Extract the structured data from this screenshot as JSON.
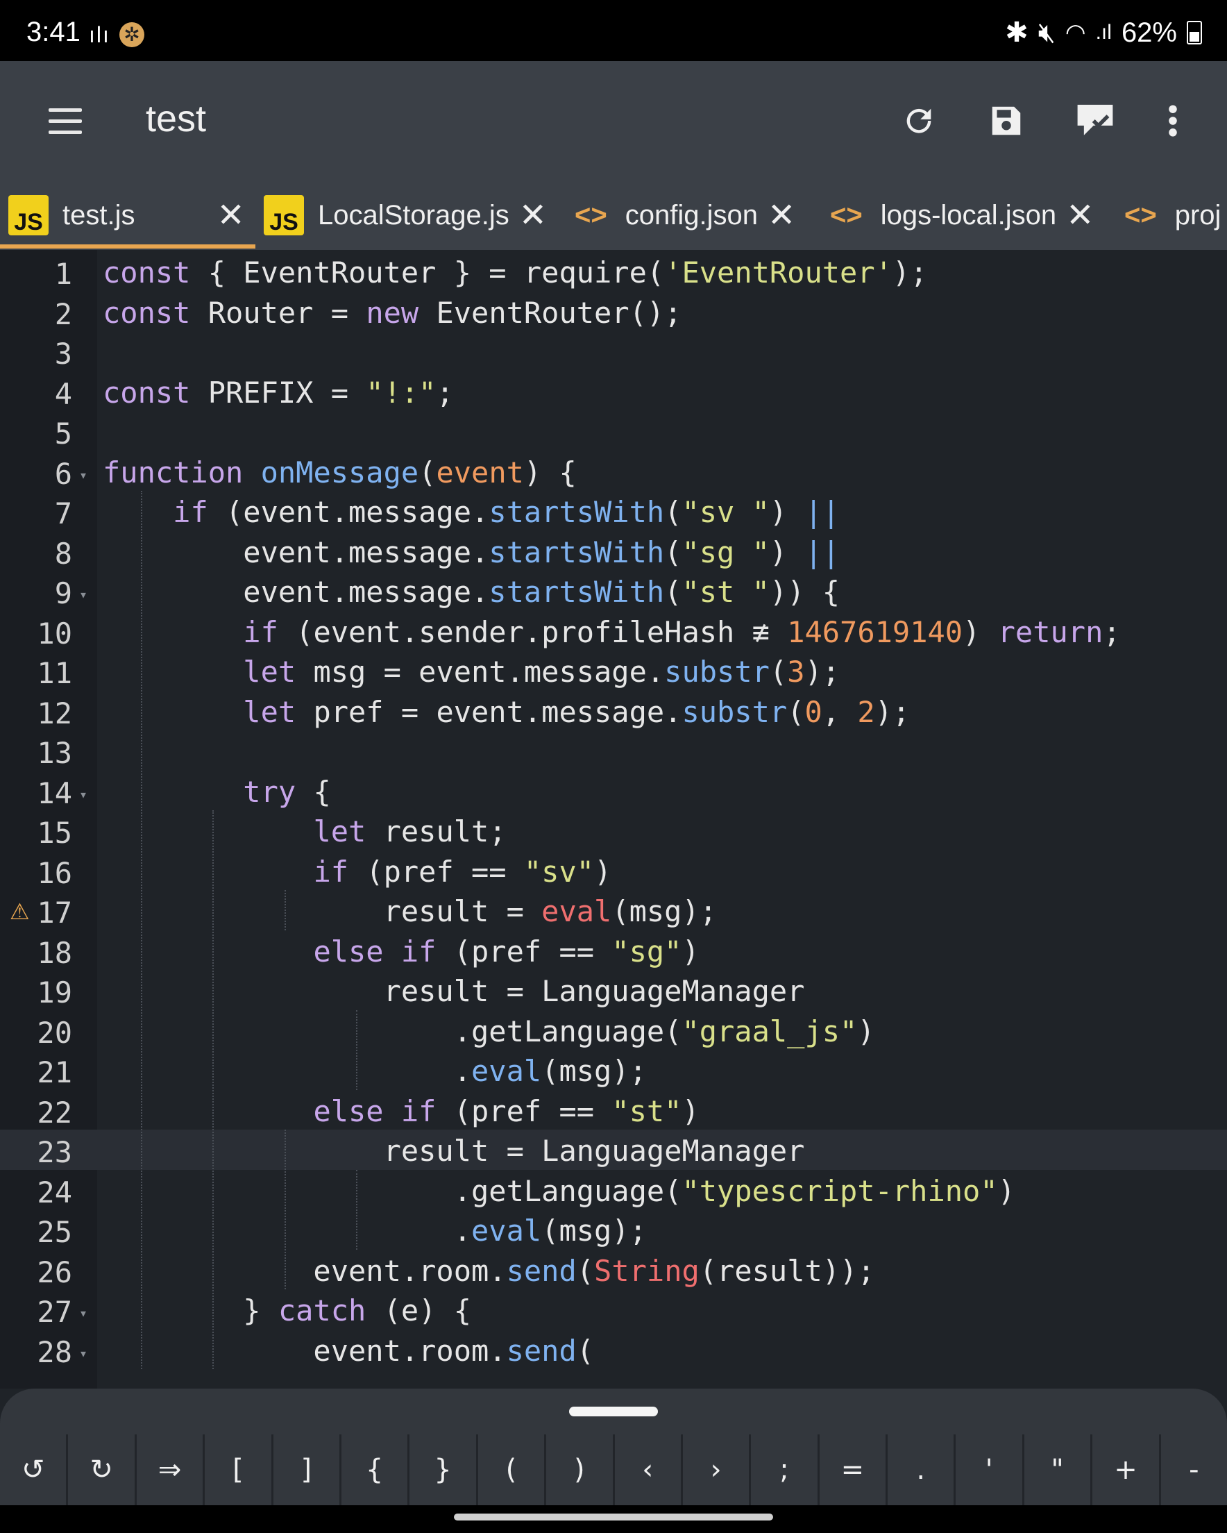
{
  "status_bar": {
    "time": "3:41",
    "battery": "62%"
  },
  "toolbar": {
    "title": "test",
    "icons": [
      "menu-icon",
      "refresh-icon",
      "save-icon",
      "run-icon",
      "more-vert-icon"
    ]
  },
  "tabs": [
    {
      "icon": "JS",
      "label": "test.js",
      "active": true
    },
    {
      "icon": "JS",
      "label": "LocalStorage.js",
      "active": false
    },
    {
      "icon": "<>",
      "label": "config.json",
      "active": false
    },
    {
      "icon": "<>",
      "label": "logs-local.json",
      "active": false
    },
    {
      "icon": "<>",
      "label": "proj",
      "active": false
    }
  ],
  "editor": {
    "active_line": 23,
    "warning_line": 17,
    "lines": [
      {
        "n": "1",
        "tokens": [
          [
            "kw",
            "const"
          ],
          [
            "op",
            " { EventRouter } = require("
          ],
          [
            "str",
            "'EventRouter'"
          ],
          [
            "op",
            ");"
          ]
        ]
      },
      {
        "n": "2",
        "tokens": [
          [
            "kw",
            "const"
          ],
          [
            "op",
            " Router = "
          ],
          [
            "kw",
            "new"
          ],
          [
            "op",
            " EventRouter();"
          ]
        ]
      },
      {
        "n": "3",
        "tokens": []
      },
      {
        "n": "4",
        "tokens": [
          [
            "kw",
            "const"
          ],
          [
            "op",
            " PREFIX = "
          ],
          [
            "str",
            "\"!:\""
          ],
          [
            "op",
            ";"
          ]
        ]
      },
      {
        "n": "5",
        "tokens": []
      },
      {
        "n": "6",
        "fold": true,
        "tokens": [
          [
            "kw",
            "function"
          ],
          [
            "op",
            " "
          ],
          [
            "fn",
            "onMessage"
          ],
          [
            "op",
            "("
          ],
          [
            "param",
            "event"
          ],
          [
            "op",
            ") {"
          ]
        ]
      },
      {
        "n": "7",
        "tokens": [
          [
            "op",
            "    "
          ],
          [
            "kw",
            "if"
          ],
          [
            "op",
            " (event.message."
          ],
          [
            "fn",
            "startsWith"
          ],
          [
            "op",
            "("
          ],
          [
            "str",
            "\"sv \""
          ],
          [
            "op",
            ") "
          ],
          [
            "fn",
            "||"
          ]
        ]
      },
      {
        "n": "8",
        "tokens": [
          [
            "op",
            "        event.message."
          ],
          [
            "fn",
            "startsWith"
          ],
          [
            "op",
            "("
          ],
          [
            "str",
            "\"sg \""
          ],
          [
            "op",
            ") "
          ],
          [
            "fn",
            "||"
          ]
        ]
      },
      {
        "n": "9",
        "fold": true,
        "tokens": [
          [
            "op",
            "        event.message."
          ],
          [
            "fn",
            "startsWith"
          ],
          [
            "op",
            "("
          ],
          [
            "str",
            "\"st \""
          ],
          [
            "op",
            ")) {"
          ]
        ]
      },
      {
        "n": "10",
        "tokens": [
          [
            "op",
            "        "
          ],
          [
            "kw",
            "if"
          ],
          [
            "op",
            " (event.sender.profileHash ≢ "
          ],
          [
            "num",
            "1467619140"
          ],
          [
            "op",
            ") "
          ],
          [
            "kw",
            "return"
          ],
          [
            "op",
            ";"
          ]
        ]
      },
      {
        "n": "11",
        "tokens": [
          [
            "op",
            "        "
          ],
          [
            "kw",
            "let"
          ],
          [
            "op",
            " msg = event.message."
          ],
          [
            "fn",
            "substr"
          ],
          [
            "op",
            "("
          ],
          [
            "num",
            "3"
          ],
          [
            "op",
            ");"
          ]
        ]
      },
      {
        "n": "12",
        "tokens": [
          [
            "op",
            "        "
          ],
          [
            "kw",
            "let"
          ],
          [
            "op",
            " pref = event.message."
          ],
          [
            "fn",
            "substr"
          ],
          [
            "op",
            "("
          ],
          [
            "num",
            "0"
          ],
          [
            "op",
            ", "
          ],
          [
            "num",
            "2"
          ],
          [
            "op",
            ");"
          ]
        ]
      },
      {
        "n": "13",
        "tokens": []
      },
      {
        "n": "14",
        "fold": true,
        "tokens": [
          [
            "op",
            "        "
          ],
          [
            "kw",
            "try"
          ],
          [
            "op",
            " {"
          ]
        ]
      },
      {
        "n": "15",
        "tokens": [
          [
            "op",
            "            "
          ],
          [
            "kw",
            "let"
          ],
          [
            "op",
            " result;"
          ]
        ]
      },
      {
        "n": "16",
        "tokens": [
          [
            "op",
            "            "
          ],
          [
            "kw",
            "if"
          ],
          [
            "op",
            " (pref == "
          ],
          [
            "str",
            "\"sv\""
          ],
          [
            "op",
            ")"
          ]
        ]
      },
      {
        "n": "17",
        "tokens": [
          [
            "op",
            "                result = "
          ],
          [
            "builtin",
            "eval"
          ],
          [
            "op",
            "(msg);"
          ]
        ]
      },
      {
        "n": "18",
        "tokens": [
          [
            "op",
            "            "
          ],
          [
            "kw",
            "else if"
          ],
          [
            "op",
            " (pref == "
          ],
          [
            "str",
            "\"sg\""
          ],
          [
            "op",
            ")"
          ]
        ]
      },
      {
        "n": "19",
        "tokens": [
          [
            "op",
            "                result = LanguageManager"
          ]
        ]
      },
      {
        "n": "20",
        "tokens": [
          [
            "op",
            "                    .getLanguage("
          ],
          [
            "str",
            "\"graal_js\""
          ],
          [
            "op",
            ")"
          ]
        ]
      },
      {
        "n": "21",
        "tokens": [
          [
            "op",
            "                    ."
          ],
          [
            "fn",
            "eval"
          ],
          [
            "op",
            "(msg);"
          ]
        ]
      },
      {
        "n": "22",
        "tokens": [
          [
            "op",
            "            "
          ],
          [
            "kw",
            "else if"
          ],
          [
            "op",
            " (pref == "
          ],
          [
            "str",
            "\"st\""
          ],
          [
            "op",
            ")"
          ]
        ]
      },
      {
        "n": "23",
        "tokens": [
          [
            "op",
            "                result = LanguageManager"
          ]
        ]
      },
      {
        "n": "24",
        "tokens": [
          [
            "op",
            "                    .getLanguage("
          ],
          [
            "str",
            "\"typescript-rhino\""
          ],
          [
            "op",
            ")"
          ]
        ]
      },
      {
        "n": "25",
        "tokens": [
          [
            "op",
            "                    ."
          ],
          [
            "fn",
            "eval"
          ],
          [
            "op",
            "(msg);"
          ]
        ]
      },
      {
        "n": "26",
        "tokens": [
          [
            "op",
            "            event.room."
          ],
          [
            "fn",
            "send"
          ],
          [
            "op",
            "("
          ],
          [
            "builtin",
            "String"
          ],
          [
            "op",
            "(result));"
          ]
        ]
      },
      {
        "n": "27",
        "fold": true,
        "tokens": [
          [
            "op",
            "        } "
          ],
          [
            "kw",
            "catch"
          ],
          [
            "op",
            " (e) {"
          ]
        ]
      },
      {
        "n": "28",
        "fold": true,
        "tokens": [
          [
            "op",
            "            event.room."
          ],
          [
            "fn",
            "send"
          ],
          [
            "op",
            "("
          ]
        ]
      }
    ]
  },
  "keyboard_bar": {
    "keys": [
      "↺",
      "↻",
      "⇒",
      "[",
      "]",
      "{",
      "}",
      "(",
      ")",
      "‹",
      "›",
      ";",
      "=",
      ".",
      "'",
      "\"",
      "+",
      "-"
    ]
  }
}
